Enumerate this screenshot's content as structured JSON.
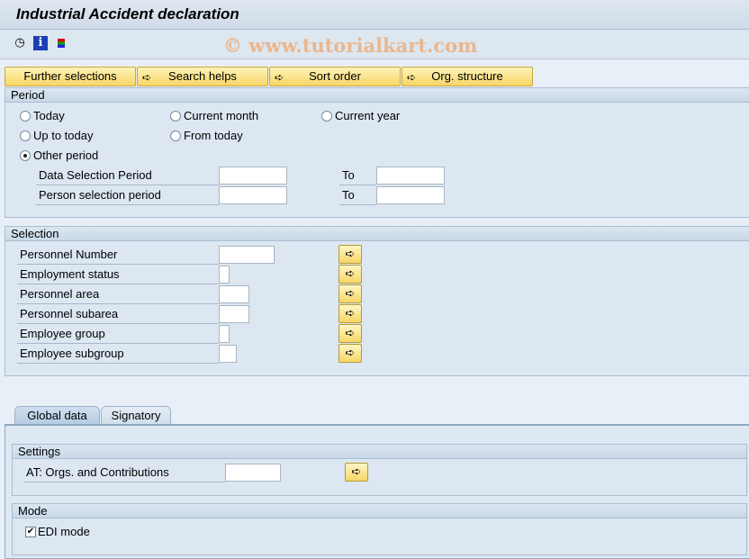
{
  "title": "Industrial Accident declaration",
  "toolbar": {
    "icons": [
      "execute-clock-icon",
      "info-icon",
      "selection-options-icon"
    ]
  },
  "watermark": "© www.tutorialkart.com",
  "buttons": [
    "Further selections",
    "Search helps",
    "Sort order",
    "Org. structure"
  ],
  "period": {
    "title": "Period",
    "options": [
      "Today",
      "Current month",
      "Current year",
      "Up to today",
      "From today",
      "Other period"
    ],
    "selected": "Other period",
    "fields": [
      {
        "label": "Data Selection Period",
        "from": "",
        "to_label": "To",
        "to": ""
      },
      {
        "label": "Person selection period",
        "from": "",
        "to_label": "To",
        "to": ""
      }
    ]
  },
  "selection": {
    "title": "Selection",
    "fields": [
      {
        "label": "Personnel Number",
        "value": ""
      },
      {
        "label": "Employment status",
        "value": ""
      },
      {
        "label": "Personnel area",
        "value": ""
      },
      {
        "label": "Personnel subarea",
        "value": ""
      },
      {
        "label": "Employee group",
        "value": ""
      },
      {
        "label": "Employee subgroup",
        "value": ""
      }
    ]
  },
  "tabs": [
    {
      "label": "Global data",
      "active": true
    },
    {
      "label": "Signatory",
      "active": false
    }
  ],
  "settings": {
    "title": "Settings",
    "field_label": "AT: Orgs. and Contributions",
    "value": ""
  },
  "mode": {
    "title": "Mode",
    "checkbox_label": "EDI mode",
    "checked": true
  },
  "colors": {
    "button": "#f7d667",
    "background": "#dce7f2"
  }
}
